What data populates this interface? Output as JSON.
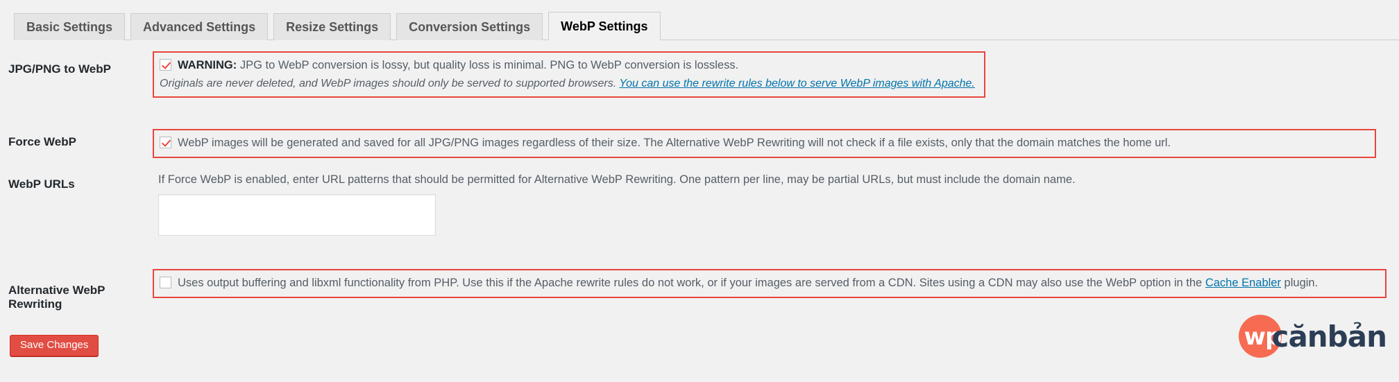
{
  "tabs": [
    {
      "label": "Basic Settings",
      "active": false
    },
    {
      "label": "Advanced Settings",
      "active": false
    },
    {
      "label": "Resize Settings",
      "active": false
    },
    {
      "label": "Conversion Settings",
      "active": false
    },
    {
      "label": "WebP Settings",
      "active": true
    }
  ],
  "rows": {
    "jpg_png_to_webp": {
      "label": "JPG/PNG to WebP",
      "checked": true,
      "warning_prefix": "WARNING:",
      "warning_text": " JPG to WebP conversion is lossy, but quality loss is minimal. PNG to WebP conversion is lossless.",
      "italic_text": "Originals are never deleted, and WebP images should only be served to supported browsers. ",
      "italic_link": "You can use the rewrite rules below to serve WebP images with Apache."
    },
    "force_webp": {
      "label": "Force WebP",
      "checked": true,
      "description": "WebP images will be generated and saved for all JPG/PNG images regardless of their size. The Alternative WebP Rewriting will not check if a file exists, only that the domain matches the home url."
    },
    "webp_urls": {
      "label": "WebP URLs",
      "description": "If Force WebP is enabled, enter URL patterns that should be permitted for Alternative WebP Rewriting. One pattern per line, may be partial URLs, but must include the domain name.",
      "value": "",
      "placeholder": ""
    },
    "alternative_webp_rewriting": {
      "label": "Alternative WebP Rewriting",
      "checked": false,
      "description_part1": "Uses output buffering and libxml functionality from PHP. Use this if the Apache rewrite rules do not work, or if your images are served from a CDN. Sites using a CDN may also use the WebP option in the ",
      "description_link": "Cache Enabler",
      "description_part2": " plugin."
    }
  },
  "save_button": {
    "label": "Save Changes"
  },
  "logo": {
    "mark_text": "wp",
    "text": "cănbản"
  },
  "colors": {
    "highlight_border": "#e8453c",
    "link": "#0073aa",
    "button": "#e14d43",
    "logo_mark": "#f76b52",
    "logo_text": "#2c3e55"
  }
}
